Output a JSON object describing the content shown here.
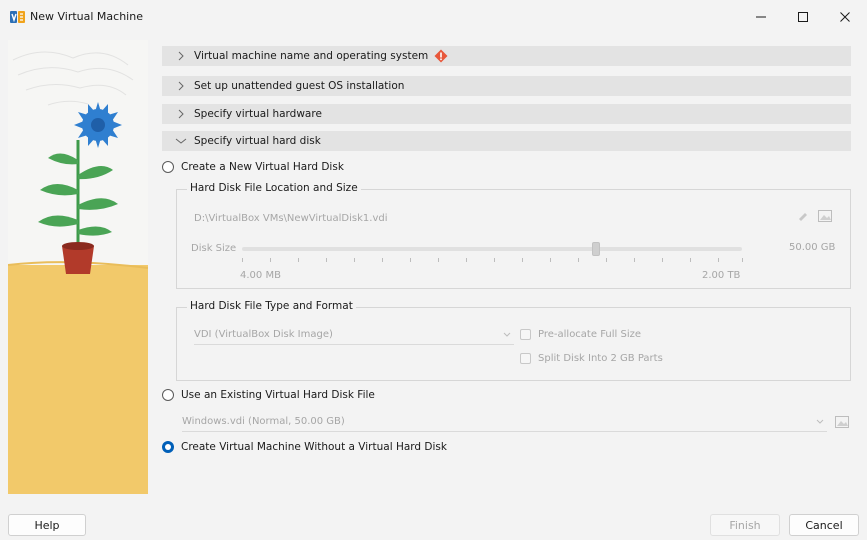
{
  "window": {
    "title": "New Virtual Machine"
  },
  "sections": [
    {
      "label": "Virtual machine name and operating system",
      "expanded": false,
      "warning": true
    },
    {
      "label": "Set up unattended guest OS installation",
      "expanded": false
    },
    {
      "label": "Specify virtual hardware",
      "expanded": false
    },
    {
      "label": "Specify virtual hard disk",
      "expanded": true
    }
  ],
  "disk": {
    "create_new_label": "Create a New Virtual Hard Disk",
    "location_group_title": "Hard Disk File Location and Size",
    "file_path": "D:\\VirtualBox VMs\\NewVirtualDisk1.vdi",
    "disk_size_label": "Disk Size",
    "disk_size_value": "50.00 GB",
    "slider_min_label": "4.00 MB",
    "slider_max_label": "2.00 TB",
    "type_group_title": "Hard Disk File Type and Format",
    "type_selected": "VDI (VirtualBox Disk Image)",
    "preallocate_label": "Pre-allocate Full Size",
    "split_label": "Split Disk Into 2 GB Parts",
    "use_existing_label": "Use an Existing Virtual Hard Disk File",
    "existing_selected": "Windows.vdi (Normal, 50.00 GB)",
    "no_disk_label": "Create Virtual Machine Without a Virtual Hard Disk",
    "selected_option": "no_disk"
  },
  "footer": {
    "help_label": "Help",
    "finish_label": "Finish",
    "cancel_label": "Cancel"
  },
  "colors": {
    "accent": "#005fb8",
    "warning": "#e8573a",
    "illustration_ground": "#f2c96a",
    "flower": "#2f7fd0"
  }
}
